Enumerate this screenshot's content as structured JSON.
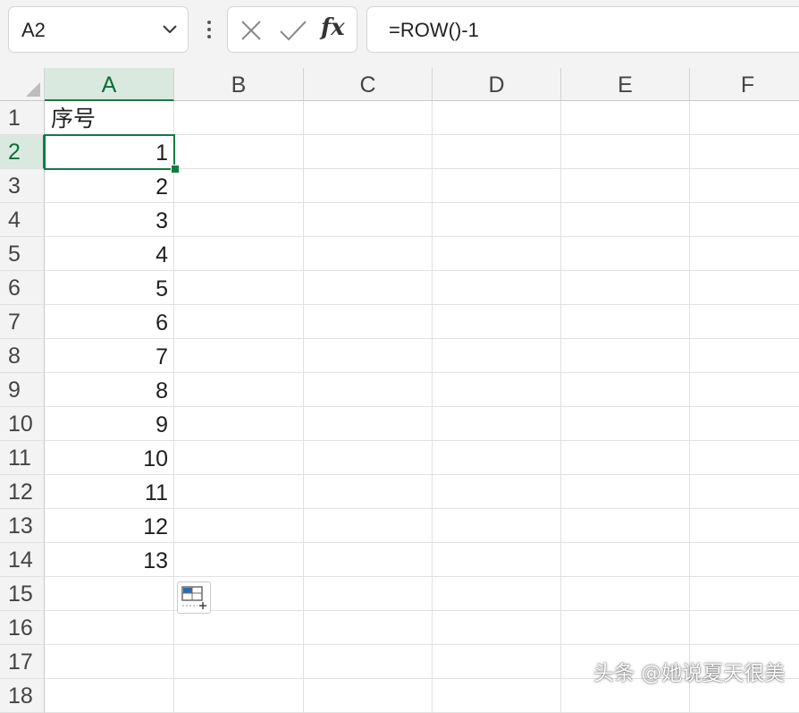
{
  "formula_bar": {
    "name_box": "A2",
    "formula": "=ROW()-1",
    "function_symbol": "fx"
  },
  "columns": [
    "A",
    "B",
    "C",
    "D",
    "E",
    "F"
  ],
  "selected_column": "A",
  "rows": [
    "1",
    "2",
    "3",
    "4",
    "5",
    "6",
    "7",
    "8",
    "9",
    "10",
    "11",
    "12",
    "13",
    "14",
    "15",
    "16",
    "17",
    "18"
  ],
  "selected_row": "2",
  "active_cell": "A2",
  "column_a": {
    "a1": "序号",
    "a2": "1",
    "a3": "2",
    "a4": "3",
    "a5": "4",
    "a6": "5",
    "a7": "6",
    "a8": "7",
    "a9": "8",
    "a10": "9",
    "a11": "10",
    "a12": "11",
    "a13": "12",
    "a14": "13"
  },
  "watermark": "头条 @她说夏天很美",
  "colors": {
    "selection": "#107c41",
    "header_selected_bg": "#d9e9df"
  }
}
